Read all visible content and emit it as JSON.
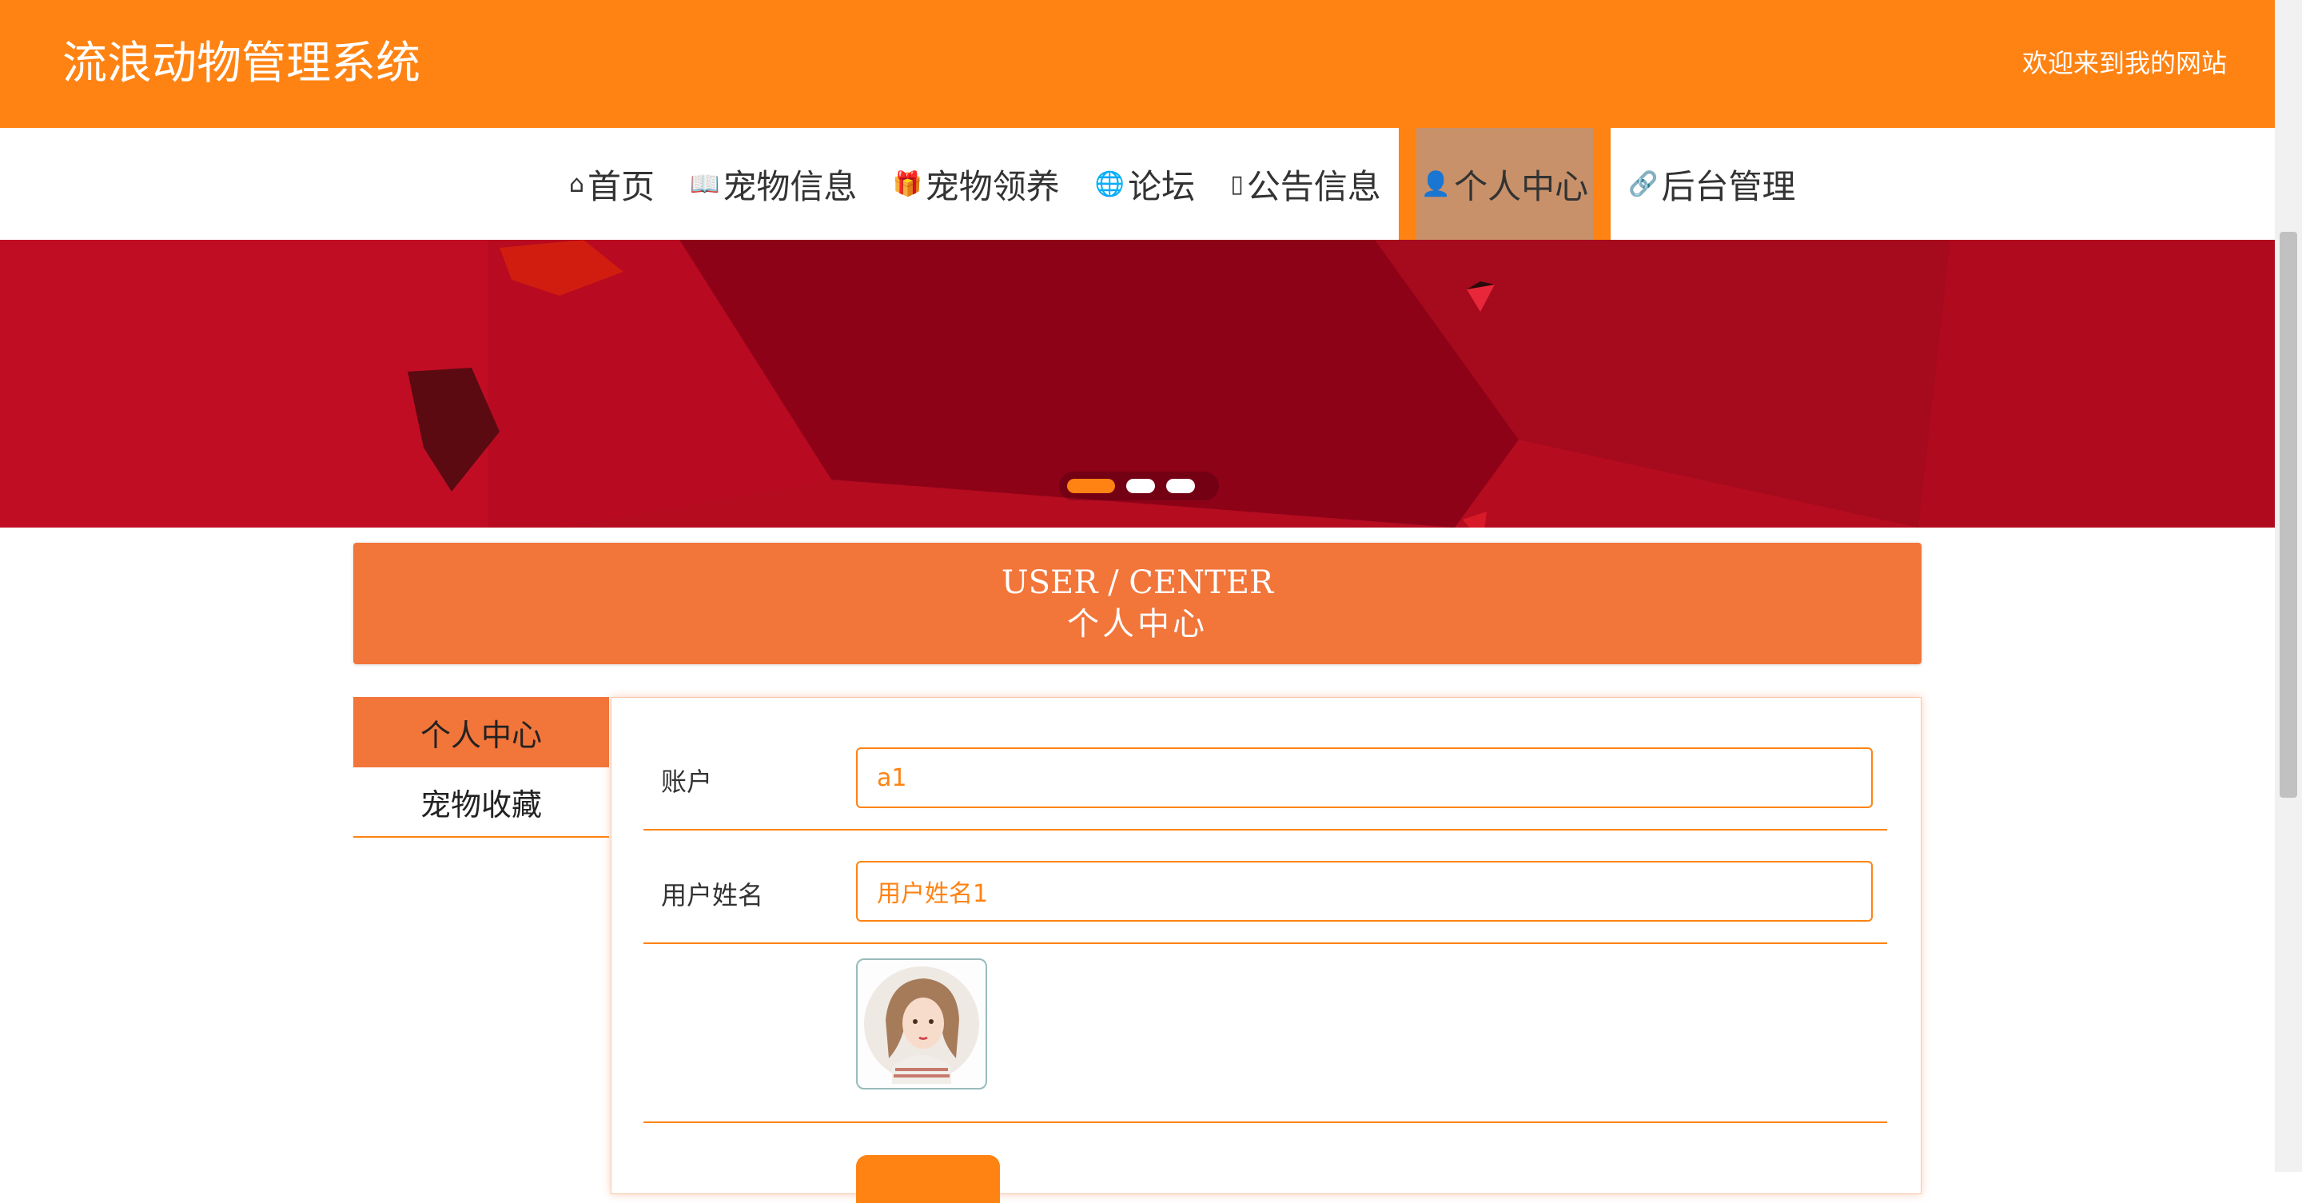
{
  "header": {
    "site_title": "流浪动物管理系统",
    "welcome": "欢迎来到我的网站"
  },
  "nav": {
    "items": [
      {
        "label": "首页",
        "icon": "home-icon"
      },
      {
        "label": "宠物信息",
        "icon": "book-icon"
      },
      {
        "label": "宠物领养",
        "icon": "gift-icon"
      },
      {
        "label": "论坛",
        "icon": "globe-icon"
      },
      {
        "label": "公告信息",
        "icon": "document-icon"
      },
      {
        "label": "个人中心",
        "icon": "user-icon",
        "active": true
      },
      {
        "label": "后台管理",
        "icon": "link-icon"
      }
    ]
  },
  "banner": {
    "slides_total": 3,
    "active_slide": 1
  },
  "center_header": {
    "en": "USER / CENTER",
    "zh": "个人中心"
  },
  "side_menu": {
    "items": [
      "个人中心",
      "宠物收藏"
    ],
    "active": "个人中心"
  },
  "form": {
    "account_label": "账户",
    "account_value": "a1",
    "name_label": "用户姓名",
    "name_value": "用户姓名1"
  },
  "colors": {
    "accent": "#ff8313",
    "panel_header": "#f2753a",
    "banner": "#b00d1f"
  }
}
